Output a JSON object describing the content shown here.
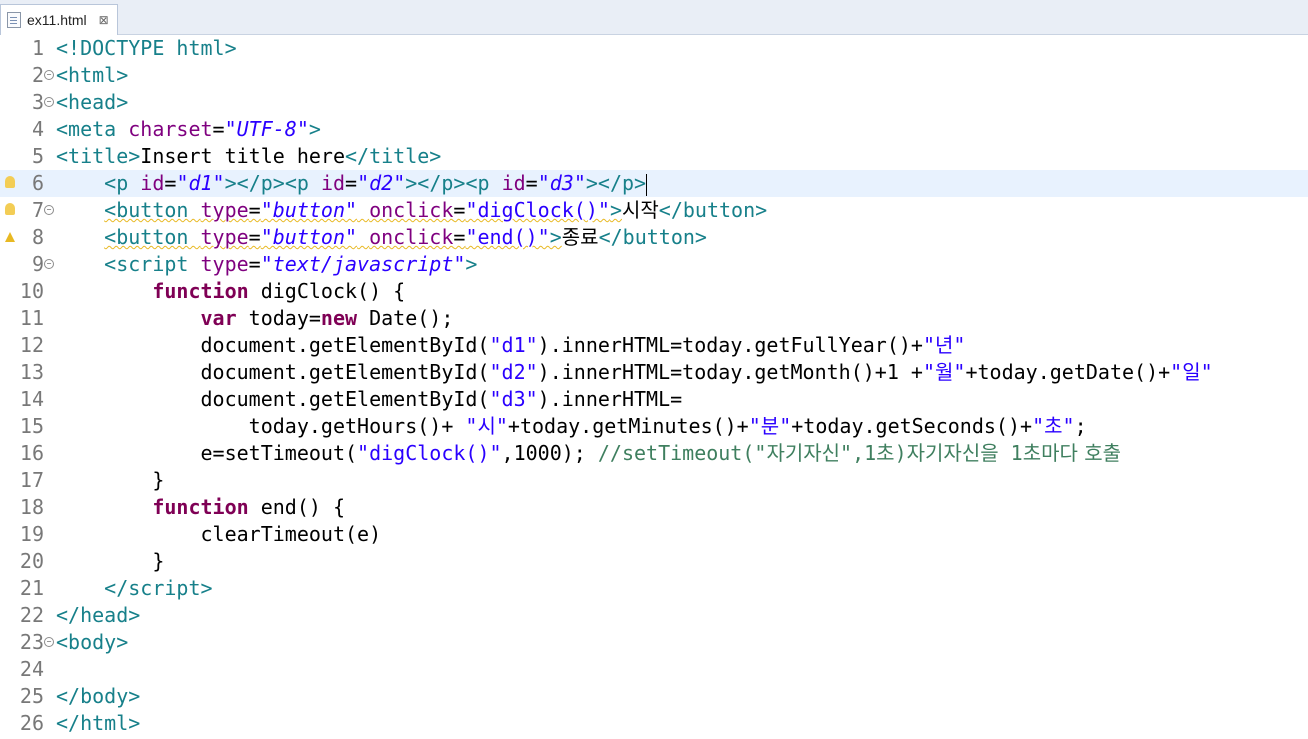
{
  "tab": {
    "filename": "ex11.html",
    "close": "⊠"
  },
  "lines": [
    {
      "n": "1",
      "html": "<span class=\"tag\">&lt;!DOCTYPE html&gt;</span>"
    },
    {
      "n": "2",
      "fold": true,
      "html": "<span class=\"tag\">&lt;html&gt;</span>"
    },
    {
      "n": "3",
      "fold": true,
      "html": "<span class=\"tag\">&lt;head&gt;</span>"
    },
    {
      "n": "4",
      "html": "<span class=\"tag\">&lt;meta </span><span class=\"attr\">charset</span>=<span class=\"val\">\"UTF-8\"</span><span class=\"tag\">&gt;</span>"
    },
    {
      "n": "5",
      "html": "<span class=\"tag\">&lt;title&gt;</span>Insert title here<span class=\"tag\">&lt;/title&gt;</span>"
    },
    {
      "n": "6",
      "current": true,
      "warn": "bulb",
      "html": "    <span class=\"tag\">&lt;p </span><span class=\"attr\">id</span>=<span class=\"val\">\"d1\"</span><span class=\"tag\">&gt;&lt;/p&gt;&lt;p </span><span class=\"attr\">id</span>=<span class=\"val\">\"d2\"</span><span class=\"tag\">&gt;&lt;/p&gt;&lt;p </span><span class=\"attr\">id</span>=<span class=\"val\">\"d3\"</span><span class=\"tag\">&gt;&lt;/p&gt;</span><span class=\"caret\"></span>"
    },
    {
      "n": "7",
      "fold": true,
      "warn": "bulb",
      "html": "    <span class=\"squig\"><span class=\"tag\">&lt;button </span><span class=\"attr\">type</span>=<span class=\"val\">\"button\"</span> <span class=\"attr\">onclick</span>=<span class=\"str\">\"digClock()\"</span><span class=\"tag\">&gt;</span></span><span class=\"ko\">시작</span><span class=\"tag\">&lt;/button&gt;</span>"
    },
    {
      "n": "8",
      "warn": "tri",
      "html": "    <span class=\"squig\"><span class=\"tag\">&lt;button </span><span class=\"attr\">type</span>=<span class=\"val\">\"button\"</span> <span class=\"attr\">onclick</span>=<span class=\"str\">\"end()\"</span><span class=\"tag\">&gt;</span></span><span class=\"ko\">종료</span><span class=\"tag\">&lt;/button&gt;</span>"
    },
    {
      "n": "9",
      "fold": true,
      "html": "    <span class=\"tag\">&lt;script </span><span class=\"attr\">type</span>=<span class=\"val\">\"text/javascript\"</span><span class=\"tag\">&gt;</span>"
    },
    {
      "n": "10",
      "html": "        <span class=\"kw\">function</span> digClock() {"
    },
    {
      "n": "11",
      "html": "            <span class=\"kw\">var</span> today=<span class=\"kw\">new</span> Date();"
    },
    {
      "n": "12",
      "html": "            document.getElementById(<span class=\"str\">\"d1\"</span>).innerHTML=today.getFullYear()+<span class=\"str\">\"<span class=\"ko\">년</span>\"</span>"
    },
    {
      "n": "13",
      "html": "            document.getElementById(<span class=\"str\">\"d2\"</span>).innerHTML=today.getMonth()+1 +<span class=\"str\">\"<span class=\"ko\">월</span>\"</span>+today.getDate()+<span class=\"str\">\"<span class=\"ko\">일</span>\"</span>"
    },
    {
      "n": "14",
      "html": "            document.getElementById(<span class=\"str\">\"d3\"</span>).innerHTML="
    },
    {
      "n": "15",
      "html": "                today.getHours()+ <span class=\"str\">\"<span class=\"ko\">시</span>\"</span>+today.getMinutes()+<span class=\"str\">\"<span class=\"ko\">분</span>\"</span>+today.getSeconds()+<span class=\"str\">\"<span class=\"ko\">초</span>\"</span>;"
    },
    {
      "n": "16",
      "html": "            e=setTimeout(<span class=\"str\">\"digClock()\"</span>,1000); <span class=\"cm\">//setTimeout(\"<span class=\"ko\">자기자신</span>\",1<span class=\"ko\">초</span>)<span class=\"ko\">자기자신을</span> 1<span class=\"ko\">초마다 호출</span></span>"
    },
    {
      "n": "17",
      "html": "        }"
    },
    {
      "n": "18",
      "html": "        <span class=\"kw\">function</span> end() {"
    },
    {
      "n": "19",
      "html": "            clearTimeout(e)"
    },
    {
      "n": "20",
      "html": "        }"
    },
    {
      "n": "21",
      "html": "    <span class=\"tag\">&lt;/script&gt;</span>"
    },
    {
      "n": "22",
      "html": "<span class=\"tag\">&lt;/head&gt;</span>"
    },
    {
      "n": "23",
      "fold": true,
      "html": "<span class=\"tag\">&lt;body&gt;</span>"
    },
    {
      "n": "24",
      "html": ""
    },
    {
      "n": "25",
      "html": "<span class=\"tag\">&lt;/body&gt;</span>"
    },
    {
      "n": "26",
      "html": "<span class=\"tag\">&lt;/html&gt;</span>"
    }
  ]
}
